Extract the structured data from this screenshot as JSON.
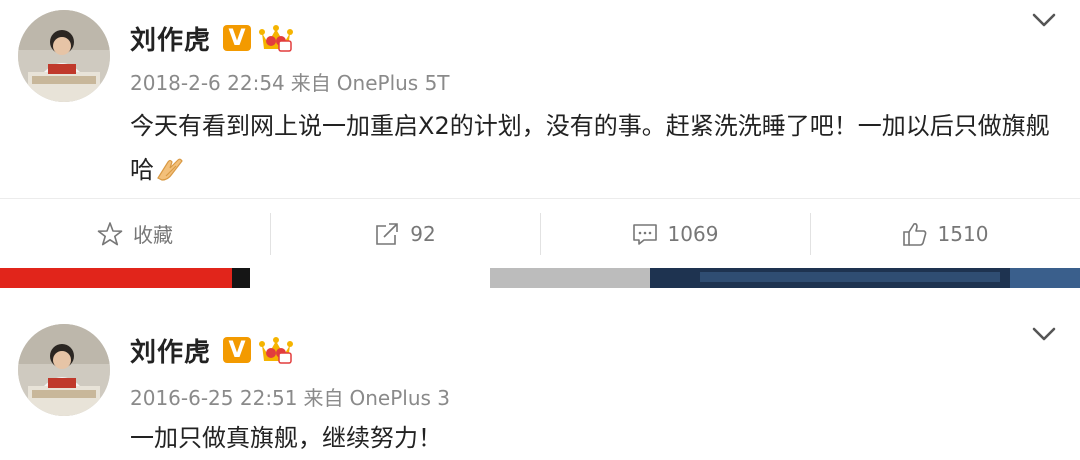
{
  "posts": [
    {
      "author": "刘作虎",
      "verified_badge": "V",
      "time": "2018-2-6 22:54",
      "source_prefix": "来自",
      "source": "OnePlus 5T",
      "text": "今天有看到网上说一加重启X2的计划，没有的事。赶紧洗洗睡了吧！一加以后只做旗舰哈",
      "emoji": "clapping-hands",
      "actions": {
        "favorite_label": "收藏",
        "repost_count": "92",
        "comment_count": "1069",
        "like_count": "1510"
      }
    },
    {
      "author": "刘作虎",
      "verified_badge": "V",
      "time": "2016-6-25 22:51",
      "source_prefix": "来自",
      "source": "OnePlus 3",
      "text": "一加只做真旗舰，继续努力！"
    }
  ],
  "icons": {
    "more": "chevron-down-icon",
    "favorite": "star-icon",
    "repost": "repost-icon",
    "comment": "comment-icon",
    "like": "thumbs-up-icon",
    "vip": "crown-icon"
  },
  "colors": {
    "verified": "#f39a00",
    "meta_text": "#8a8a8a",
    "action_text": "#777777"
  }
}
